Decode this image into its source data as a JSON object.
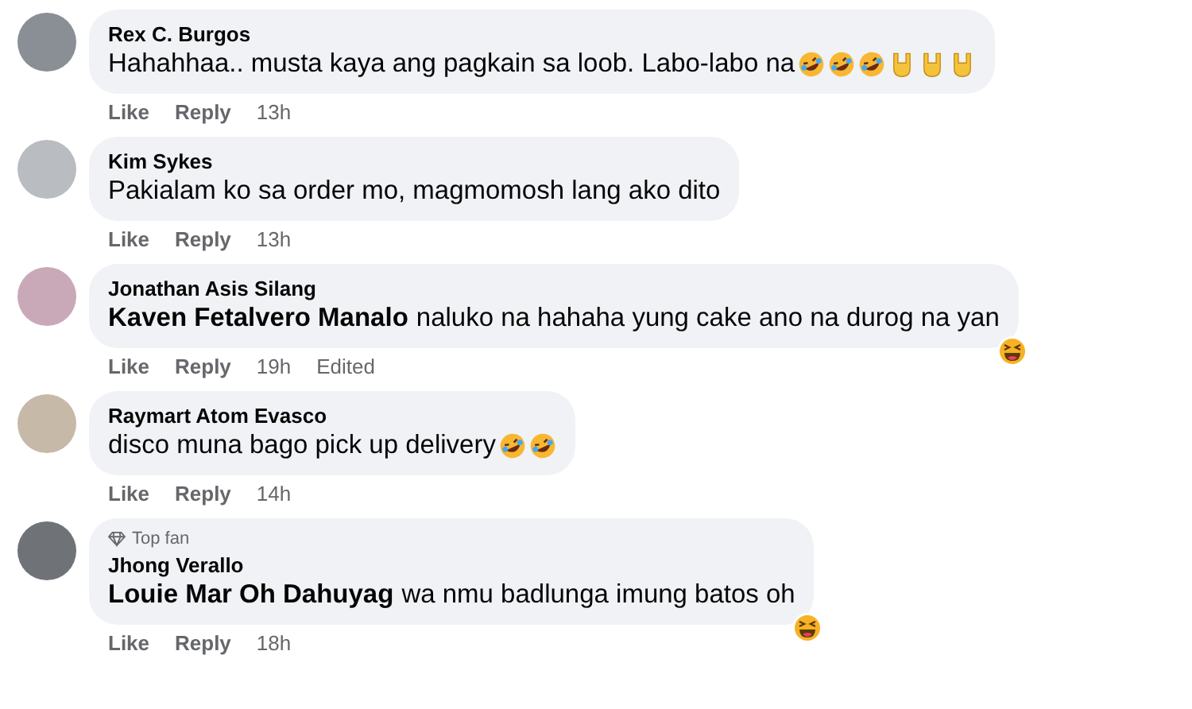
{
  "comments": [
    {
      "author": "Rex C. Burgos",
      "text": "Hahahhaa.. musta kaya ang pagkain sa loob. Labo-labo na",
      "emojis": [
        {
          "kind": "rofl"
        },
        {
          "kind": "rofl"
        },
        {
          "kind": "rofl"
        },
        {
          "kind": "horns"
        },
        {
          "kind": "horns"
        },
        {
          "kind": "horns"
        }
      ],
      "actions": [
        "Like",
        "Reply"
      ],
      "time": "13h"
    },
    {
      "author": "Kim Sykes",
      "text": "Pakialam ko sa order mo, magmomosh lang ako dito",
      "actions": [
        "Like",
        "Reply"
      ],
      "time": "13h"
    },
    {
      "author": "Jonathan Asis Silang",
      "mention": "Kaven Fetalvero Manalo",
      "text": "naluko na hahaha yung cake ano na durog na yan",
      "actions": [
        "Like",
        "Reply"
      ],
      "time": "19h",
      "edited": "Edited",
      "reaction": {
        "kind": "haha"
      }
    },
    {
      "author": "Raymart Atom Evasco",
      "text": "disco muna bago pick up delivery",
      "emojis": [
        {
          "kind": "rofl"
        },
        {
          "kind": "rofl"
        }
      ],
      "actions": [
        "Like",
        "Reply"
      ],
      "time": "14h"
    },
    {
      "badge": "Top fan",
      "author": "Jhong Verallo",
      "mention": "Louie Mar Oh Dahuyag",
      "text": "wa nmu badlunga imung batos oh",
      "actions": [
        "Like",
        "Reply"
      ],
      "time": "18h",
      "reaction": {
        "kind": "haha"
      }
    }
  ]
}
